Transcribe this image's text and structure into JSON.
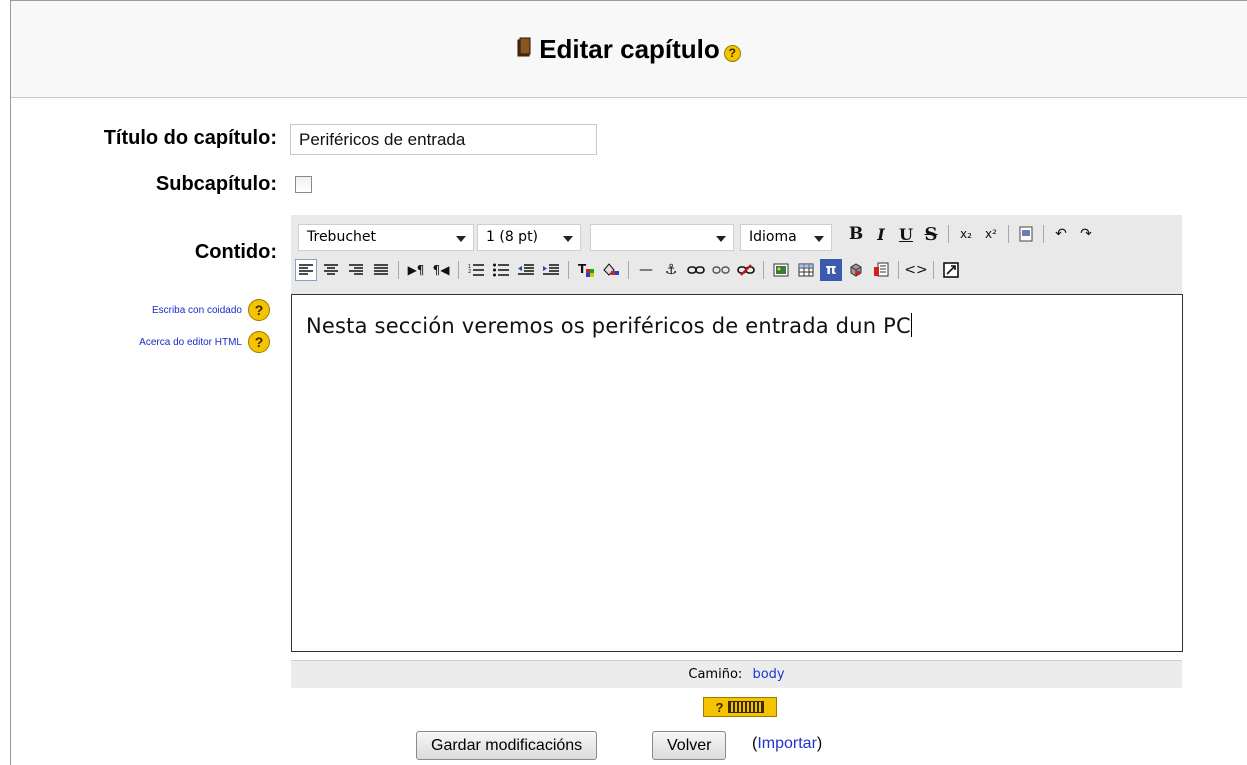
{
  "header": {
    "title": "Editar capítulo",
    "help": "?"
  },
  "form": {
    "title_label": "Título do capítulo:",
    "title_value": "Periféricos de entrada",
    "subchapter_label": "Subcapítulo:",
    "content_label": "Contido:"
  },
  "side_help": [
    {
      "label": "Escriba con coidado",
      "icon": "?"
    },
    {
      "label": "Acerca do editor HTML",
      "icon": "?"
    }
  ],
  "toolbar": {
    "font_family": "Trebuchet",
    "font_size": "1 (8 pt)",
    "heading": "",
    "language": "Idioma"
  },
  "editor": {
    "text": "Nesta sección veremos os periféricos de entrada dun PC"
  },
  "statusbar": {
    "label": "Camiño:",
    "path": "body"
  },
  "keyboard_badge": {
    "label": "?"
  },
  "actions": {
    "save": "Gardar modificacións",
    "back": "Volver",
    "import_open": "(",
    "import_link": "Importar",
    "import_close": ")"
  }
}
